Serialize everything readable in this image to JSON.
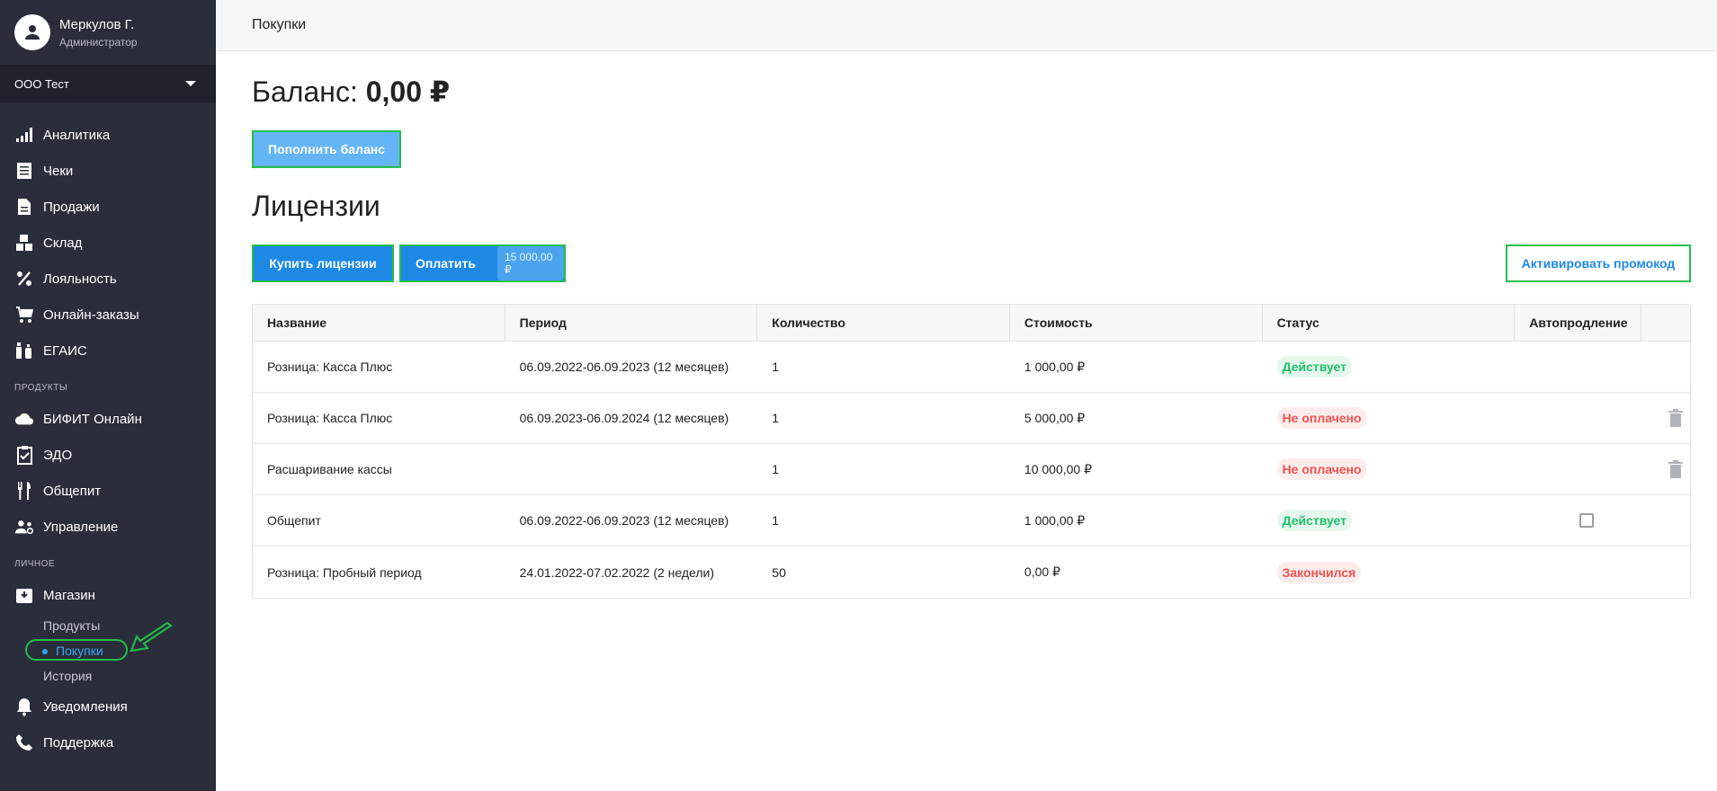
{
  "user": {
    "name": "Меркулов Г.",
    "role": "Администратор"
  },
  "org": {
    "selected": "ООО Тест"
  },
  "nav": {
    "main": [
      {
        "label": "Аналитика",
        "icon": "chart-bars-icon"
      },
      {
        "label": "Чеки",
        "icon": "receipt-icon"
      },
      {
        "label": "Продажи",
        "icon": "document-icon"
      },
      {
        "label": "Склад",
        "icon": "boxes-icon"
      },
      {
        "label": "Лояльность",
        "icon": "percent-icon"
      },
      {
        "label": "Онлайн-заказы",
        "icon": "cart-icon"
      },
      {
        "label": "ЕГАИС",
        "icon": "bottles-icon"
      }
    ],
    "products_label": "ПРОДУКТЫ",
    "products": [
      {
        "label": "БИФИТ Онлайн",
        "icon": "cloud-icon"
      },
      {
        "label": "ЭДО",
        "icon": "clipboard-check-icon"
      },
      {
        "label": "Общепит",
        "icon": "fork-knife-icon"
      },
      {
        "label": "Управление",
        "icon": "people-gear-icon"
      }
    ],
    "personal_label": "ЛИЧНОЕ",
    "shop": {
      "label": "Магазин",
      "icon": "store-box-icon"
    },
    "shop_sub": {
      "products": "Продукты",
      "purchases": "Покупки",
      "history": "История"
    },
    "bottom": [
      {
        "label": "Уведомления",
        "icon": "bell-icon"
      },
      {
        "label": "Поддержка",
        "icon": "phone-icon"
      }
    ]
  },
  "header": {
    "title": "Покупки"
  },
  "balance": {
    "label": "Баланс:",
    "value": "0,00 ₽"
  },
  "buttons": {
    "topup": "Пополнить баланс",
    "buy": "Купить лицензии",
    "pay": "Оплатить",
    "pay_amount": "15 000,00 ₽",
    "promo": "Активировать промокод"
  },
  "licenses": {
    "title": "Лицензии",
    "columns": [
      "Название",
      "Период",
      "Количество",
      "Стоимость",
      "Статус",
      "Автопродление"
    ],
    "rows": [
      {
        "name": "Розница: Касса Плюс",
        "period": "06.09.2022-06.09.2023 (12 месяцев)",
        "qty": "1",
        "cost": "1 000,00 ₽",
        "status": "Действует",
        "status_kind": "ok",
        "autorenew": "",
        "delete": false
      },
      {
        "name": "Розница: Касса Плюс",
        "period": "06.09.2023-06.09.2024 (12 месяцев)",
        "qty": "1",
        "cost": "5 000,00 ₽",
        "status": "Не оплачено",
        "status_kind": "bad",
        "autorenew": "",
        "delete": true
      },
      {
        "name": "Расшаривание кассы",
        "period": "",
        "qty": "1",
        "cost": "10 000,00 ₽",
        "status": "Не оплачено",
        "status_kind": "bad",
        "autorenew": "",
        "delete": true
      },
      {
        "name": "Общепит",
        "period": "06.09.2022-06.09.2023 (12 месяцев)",
        "qty": "1",
        "cost": "1 000,00 ₽",
        "status": "Действует",
        "status_kind": "ok",
        "autorenew": "checkbox",
        "delete": false
      },
      {
        "name": "Розница: Пробный период",
        "period": "24.01.2022-07.02.2022 (2 недели)",
        "qty": "50",
        "cost": "0,00 ₽",
        "status": "Закончился",
        "status_kind": "bad",
        "autorenew": "",
        "delete": false
      }
    ]
  },
  "colors": {
    "sidebar": "#2a2e3b",
    "primary": "#1e88e5",
    "annotation": "#21c04a"
  }
}
